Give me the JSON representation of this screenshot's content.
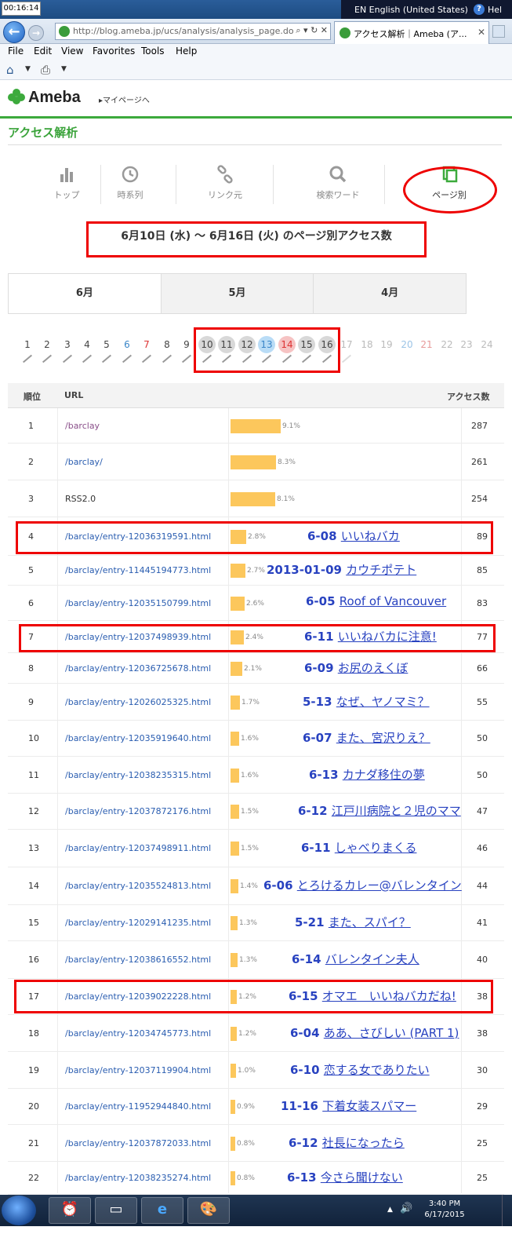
{
  "os": {
    "clock_widget": "00:16:14",
    "language": "EN English (United States)",
    "help_text": "Hel",
    "taskbar_time": "3:40 PM",
    "taskbar_date": "6/17/2015"
  },
  "browser": {
    "address": "http://blog.ameba.jp/ucs/analysis/analysis_page.do",
    "tab_title": "アクセス解析｜Ameba (ア...",
    "menu": [
      "File",
      "Edit",
      "View",
      "Favorites",
      "Tools",
      "Help"
    ]
  },
  "header": {
    "logo": "Ameba",
    "mypage_link": "▸マイページへ",
    "page_title": "アクセス解析"
  },
  "nav": [
    {
      "label": "トップ",
      "icon": "bar-chart-icon"
    },
    {
      "label": "時系列",
      "icon": "clock-icon"
    },
    {
      "label": "リンク元",
      "icon": "link-icon"
    },
    {
      "label": "検索ワード",
      "icon": "magnifier-icon"
    },
    {
      "label": "ページ別",
      "icon": "pages-icon"
    }
  ],
  "range_title": "6月10日 (水) ～ 6月16日 (火) のページ別アクセス数",
  "months": [
    "6月",
    "5月",
    "4月"
  ],
  "days": [
    "1",
    "2",
    "3",
    "4",
    "5",
    "6",
    "7",
    "8",
    "9",
    "10",
    "11",
    "12",
    "13",
    "14",
    "15",
    "16",
    "17",
    "18",
    "19",
    "20",
    "21",
    "22",
    "23",
    "24"
  ],
  "table": {
    "headers": {
      "rank": "順位",
      "url": "URL",
      "count": "アクセス数"
    },
    "rows": [
      {
        "rank": "1",
        "url": "/barclay",
        "pct": "9.1%",
        "count": "287",
        "note_date": "",
        "note_title": ""
      },
      {
        "rank": "2",
        "url": "/barclay/",
        "pct": "8.3%",
        "count": "261",
        "note_date": "",
        "note_title": ""
      },
      {
        "rank": "3",
        "url": "RSS2.0",
        "pct": "8.1%",
        "count": "254",
        "note_date": "",
        "note_title": ""
      },
      {
        "rank": "4",
        "url": "/barclay/entry-12036319591.html",
        "pct": "2.8%",
        "count": "89",
        "note_date": "6-08",
        "note_title": "いいねバカ"
      },
      {
        "rank": "5",
        "url": "/barclay/entry-11445194773.html",
        "pct": "2.7%",
        "count": "85",
        "note_date": "2013-01-09",
        "note_title": "カウチポテト"
      },
      {
        "rank": "6",
        "url": "/barclay/entry-12035150799.html",
        "pct": "2.6%",
        "count": "83",
        "note_date": "6-05",
        "note_title": "Roof of Vancouver"
      },
      {
        "rank": "7",
        "url": "/barclay/entry-12037498939.html",
        "pct": "2.4%",
        "count": "77",
        "note_date": "6-11",
        "note_title": "いいねバカに注意!"
      },
      {
        "rank": "8",
        "url": "/barclay/entry-12036725678.html",
        "pct": "2.1%",
        "count": "66",
        "note_date": "6-09",
        "note_title": "お尻のえくぼ"
      },
      {
        "rank": "9",
        "url": "/barclay/entry-12026025325.html",
        "pct": "1.7%",
        "count": "55",
        "note_date": "5-13",
        "note_title": "なぜ、ヤノマミ？"
      },
      {
        "rank": "10",
        "url": "/barclay/entry-12035919640.html",
        "pct": "1.6%",
        "count": "50",
        "note_date": "6-07",
        "note_title": "また、宮沢りえ？"
      },
      {
        "rank": "11",
        "url": "/barclay/entry-12038235315.html",
        "pct": "1.6%",
        "count": "50",
        "note_date": "6-13",
        "note_title": "カナダ移住の夢"
      },
      {
        "rank": "12",
        "url": "/barclay/entry-12037872176.html",
        "pct": "1.5%",
        "count": "47",
        "note_date": "6-12",
        "note_title": "江戸川病院と２児のママ"
      },
      {
        "rank": "13",
        "url": "/barclay/entry-12037498911.html",
        "pct": "1.5%",
        "count": "46",
        "note_date": "6-11",
        "note_title": "しゃべりまくる"
      },
      {
        "rank": "14",
        "url": "/barclay/entry-12035524813.html",
        "pct": "1.4%",
        "count": "44",
        "note_date": "6-06",
        "note_title": "とろけるカレー@バレンタイン"
      },
      {
        "rank": "15",
        "url": "/barclay/entry-12029141235.html",
        "pct": "1.3%",
        "count": "41",
        "note_date": "5-21",
        "note_title": "また、スパイ？"
      },
      {
        "rank": "16",
        "url": "/barclay/entry-12038616552.html",
        "pct": "1.3%",
        "count": "40",
        "note_date": "6-14",
        "note_title": "バレンタイン夫人"
      },
      {
        "rank": "17",
        "url": "/barclay/entry-12039022228.html",
        "pct": "1.2%",
        "count": "38",
        "note_date": "6-15",
        "note_title": "オマエ　いいねバカだね!"
      },
      {
        "rank": "18",
        "url": "/barclay/entry-12034745773.html",
        "pct": "1.2%",
        "count": "38",
        "note_date": "6-04",
        "note_title": "ああ、さびしい (PART 1)"
      },
      {
        "rank": "19",
        "url": "/barclay/entry-12037119904.html",
        "pct": "1.0%",
        "count": "30",
        "note_date": "6-10",
        "note_title": "恋する女でありたい"
      },
      {
        "rank": "20",
        "url": "/barclay/entry-11952944840.html",
        "pct": "0.9%",
        "count": "29",
        "note_date": "11-16",
        "note_title": "下着女装スパマー"
      },
      {
        "rank": "21",
        "url": "/barclay/entry-12037872033.html",
        "pct": "0.8%",
        "count": "25",
        "note_date": "6-12",
        "note_title": "社長になったら"
      },
      {
        "rank": "22",
        "url": "/barclay/entry-12038235274.html",
        "pct": "0.8%",
        "count": "25",
        "note_date": "6-13",
        "note_title": "今さら聞けない"
      }
    ]
  }
}
